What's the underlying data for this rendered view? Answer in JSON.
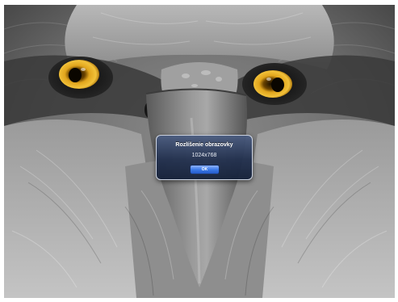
{
  "alert": {
    "title": "Rozlíšenie obrazovky",
    "message": "1024x768",
    "button_label": "OK"
  },
  "colors": {
    "alert_background": "#22304e",
    "alert_border": "#ebf0fa",
    "button_blue": "#3d7be8",
    "eye_amber": "#e1a51c"
  }
}
